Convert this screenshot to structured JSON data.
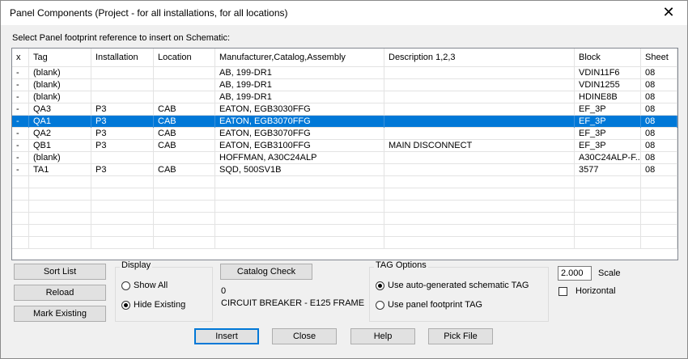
{
  "window": {
    "title": "Panel Components (Project - for all installations, for all locations)",
    "close_label": "✕"
  },
  "prompt": "Select Panel footprint reference to insert on Schematic:",
  "columns": [
    "x",
    "Tag",
    "Installation",
    "Location",
    "Manufacturer,Catalog,Assembly",
    "Description 1,2,3",
    "Block",
    "Sheet"
  ],
  "rows": [
    {
      "x": "-",
      "tag": "(blank)",
      "installation": "",
      "location": "",
      "mfr": "AB, 199-DR1",
      "desc": "",
      "block": "VDIN11F6",
      "sheet": "08"
    },
    {
      "x": "-",
      "tag": "(blank)",
      "installation": "",
      "location": "",
      "mfr": "AB, 199-DR1",
      "desc": "",
      "block": "VDIN1255",
      "sheet": "08"
    },
    {
      "x": "-",
      "tag": "(blank)",
      "installation": "",
      "location": "",
      "mfr": "AB, 199-DR1",
      "desc": "",
      "block": "HDINE8B",
      "sheet": "08"
    },
    {
      "x": "-",
      "tag": "QA3",
      "installation": "P3",
      "location": "CAB",
      "mfr": "EATON, EGB3030FFG",
      "desc": "",
      "block": "EF_3P",
      "sheet": "08"
    },
    {
      "x": "-",
      "tag": "QA1",
      "installation": "P3",
      "location": "CAB",
      "mfr": "EATON, EGB3070FFG",
      "desc": "",
      "block": "EF_3P",
      "sheet": "08",
      "selected": true
    },
    {
      "x": "-",
      "tag": "QA2",
      "installation": "P3",
      "location": "CAB",
      "mfr": "EATON, EGB3070FFG",
      "desc": "",
      "block": "EF_3P",
      "sheet": "08"
    },
    {
      "x": "-",
      "tag": "QB1",
      "installation": "P3",
      "location": "CAB",
      "mfr": "EATON, EGB3100FFG",
      "desc": "MAIN DISCONNECT",
      "block": "EF_3P",
      "sheet": "08"
    },
    {
      "x": "-",
      "tag": "(blank)",
      "installation": "",
      "location": "",
      "mfr": "HOFFMAN, A30C24ALP",
      "desc": "",
      "block": "A30C24ALP-F...",
      "sheet": "08"
    },
    {
      "x": "-",
      "tag": "TA1",
      "installation": "P3",
      "location": "CAB",
      "mfr": "SQD, 500SV1B",
      "desc": "",
      "block": "3577",
      "sheet": "08"
    }
  ],
  "left_buttons": {
    "sort_list": "Sort List",
    "reload": "Reload",
    "mark_existing": "Mark Existing"
  },
  "display": {
    "label": "Display",
    "show_all": "Show All",
    "hide_existing": "Hide Existing",
    "selected": "hide_existing"
  },
  "catalog": {
    "button": "Catalog Check",
    "count": "0",
    "description": "CIRCUIT BREAKER - E125 FRAME"
  },
  "tag_options": {
    "label": "TAG Options",
    "auto": "Use auto-generated schematic TAG",
    "footprint": "Use panel footprint TAG",
    "selected": "auto"
  },
  "scale": {
    "value": "2.000",
    "label": "Scale"
  },
  "horizontal": {
    "label": "Horizontal",
    "checked": false
  },
  "bottom_buttons": {
    "insert": "Insert",
    "close": "Close",
    "help": "Help",
    "pick_file": "Pick File"
  }
}
